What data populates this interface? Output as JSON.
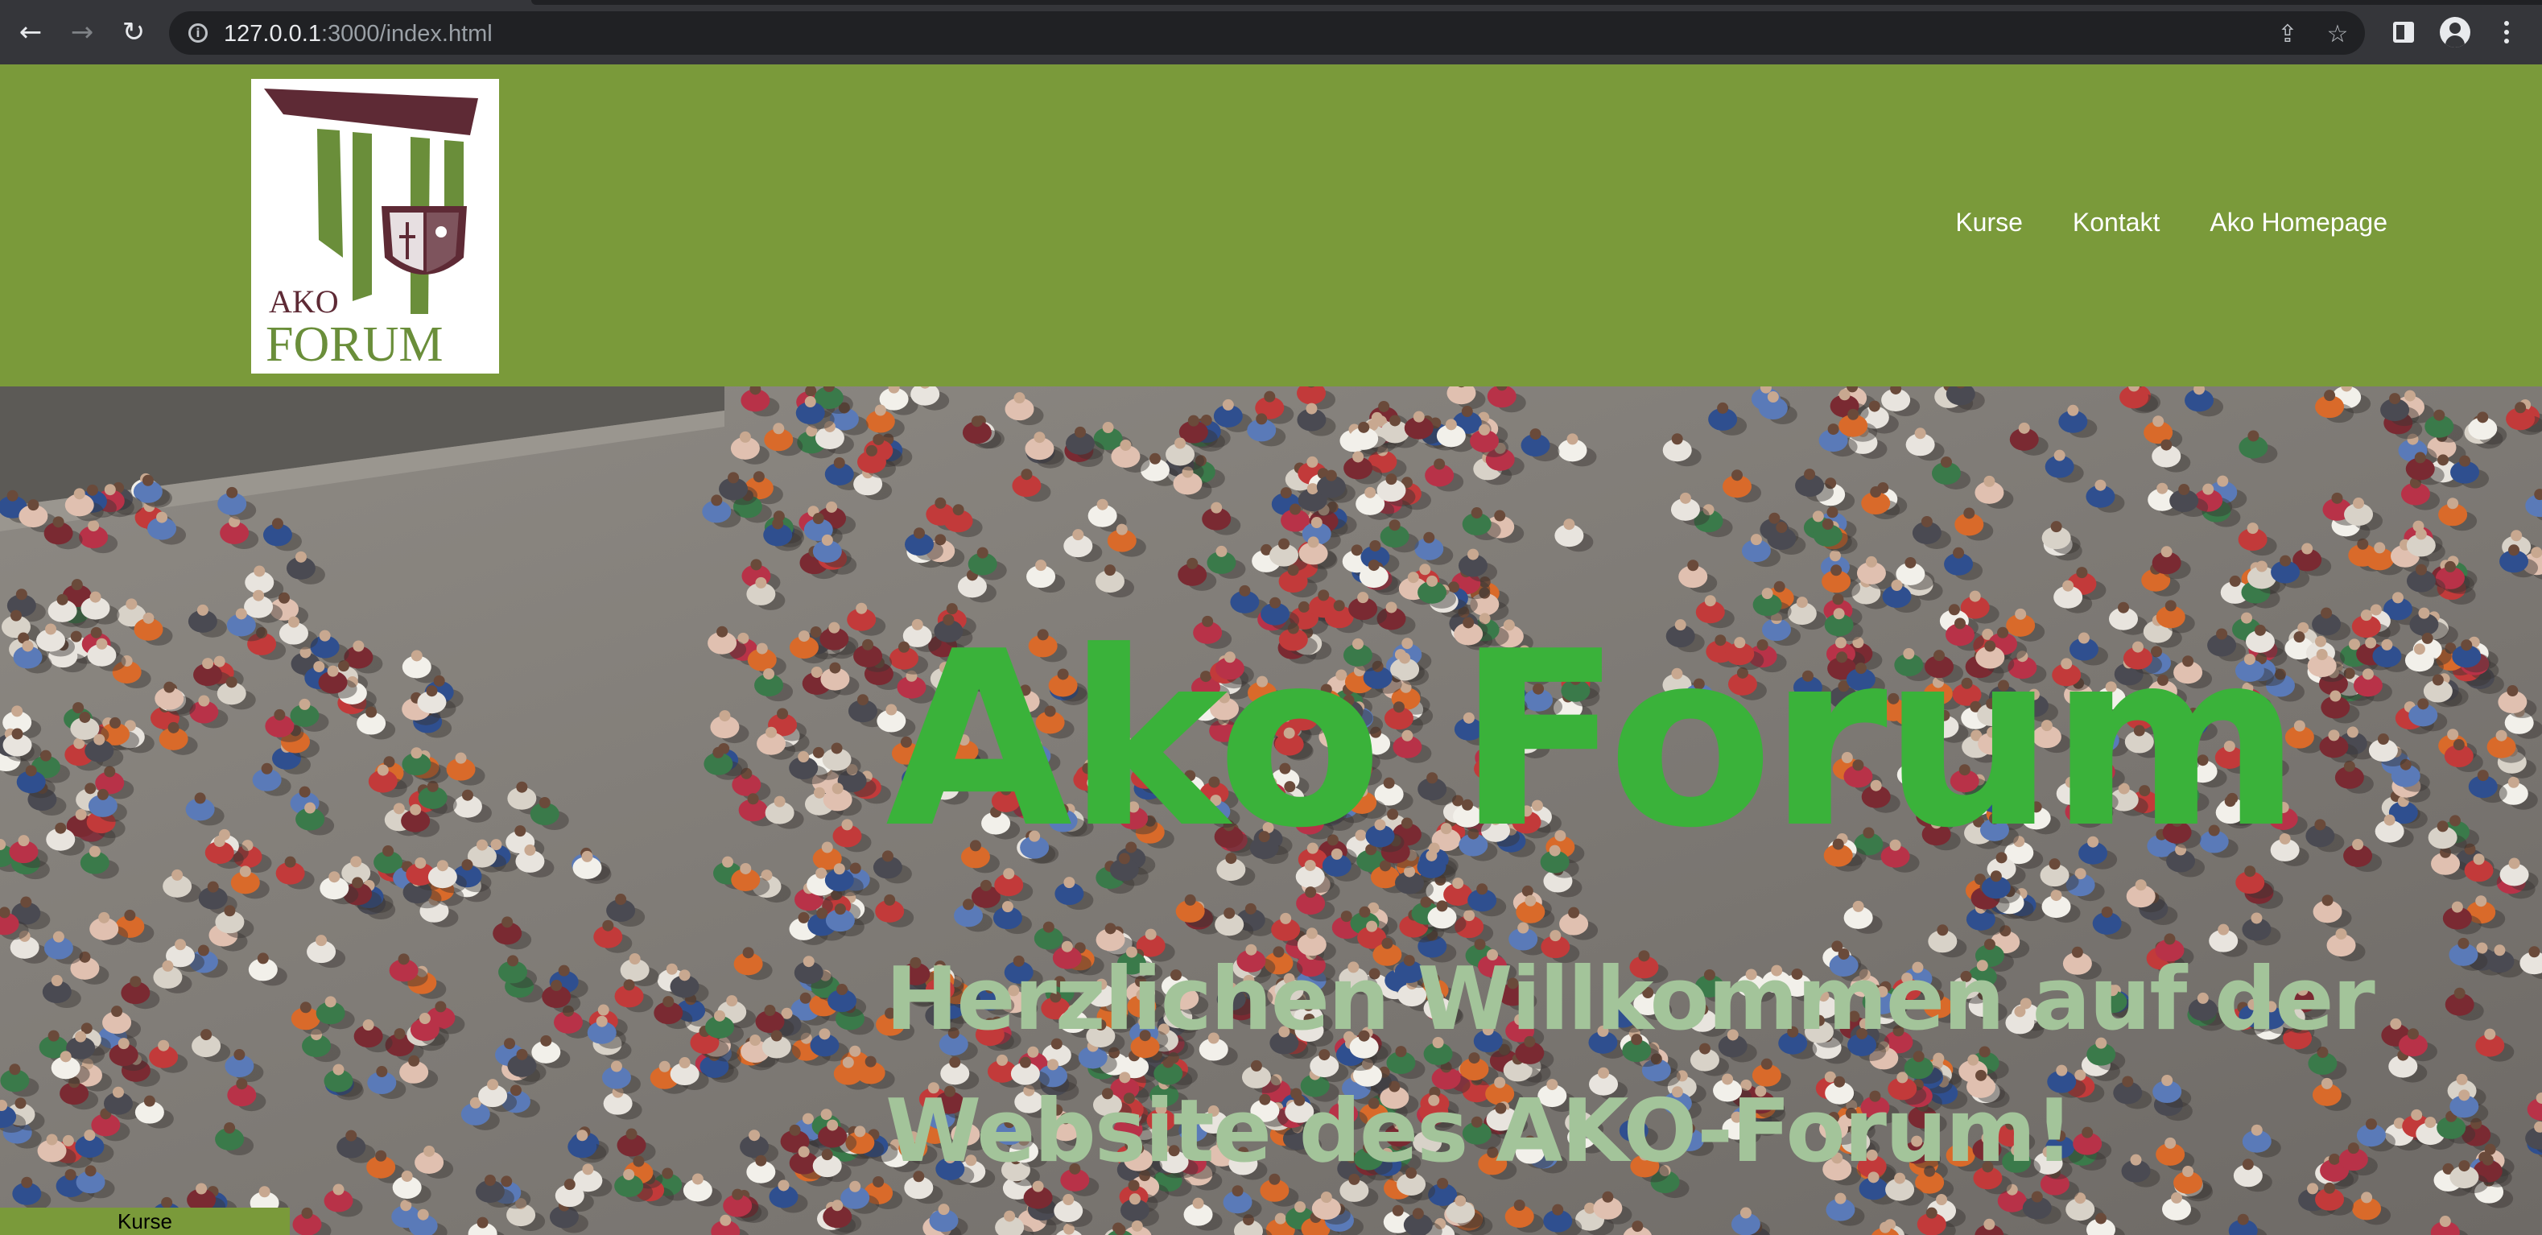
{
  "browser": {
    "url_host": "127.0.0.1",
    "url_path": ":3000/index.html",
    "icons": [
      "back-arrow-icon",
      "forward-arrow-icon",
      "reload-icon",
      "info-icon",
      "share-icon",
      "star-icon",
      "side-panel-icon",
      "profile-icon",
      "menu-kebab-icon"
    ]
  },
  "header": {
    "logo": {
      "line1": "AKO",
      "line2": "FORUM"
    },
    "nav": [
      {
        "label": "Kurse"
      },
      {
        "label": "Kontakt"
      },
      {
        "label": "Ako Homepage"
      }
    ]
  },
  "hero": {
    "title": "Ako Forum",
    "subtitle_line1": "Herzlichen Willkommen auf der",
    "subtitle_line2": "Website des AKO-Forum!"
  },
  "footer_tab": {
    "label": "Kurse"
  },
  "colors": {
    "header_green": "#7a9a3a",
    "title_green": "#3ab23a",
    "subtitle_green": "#a3c49a",
    "logo_maroon": "#5e2a35",
    "logo_green": "#6a8e3a"
  }
}
